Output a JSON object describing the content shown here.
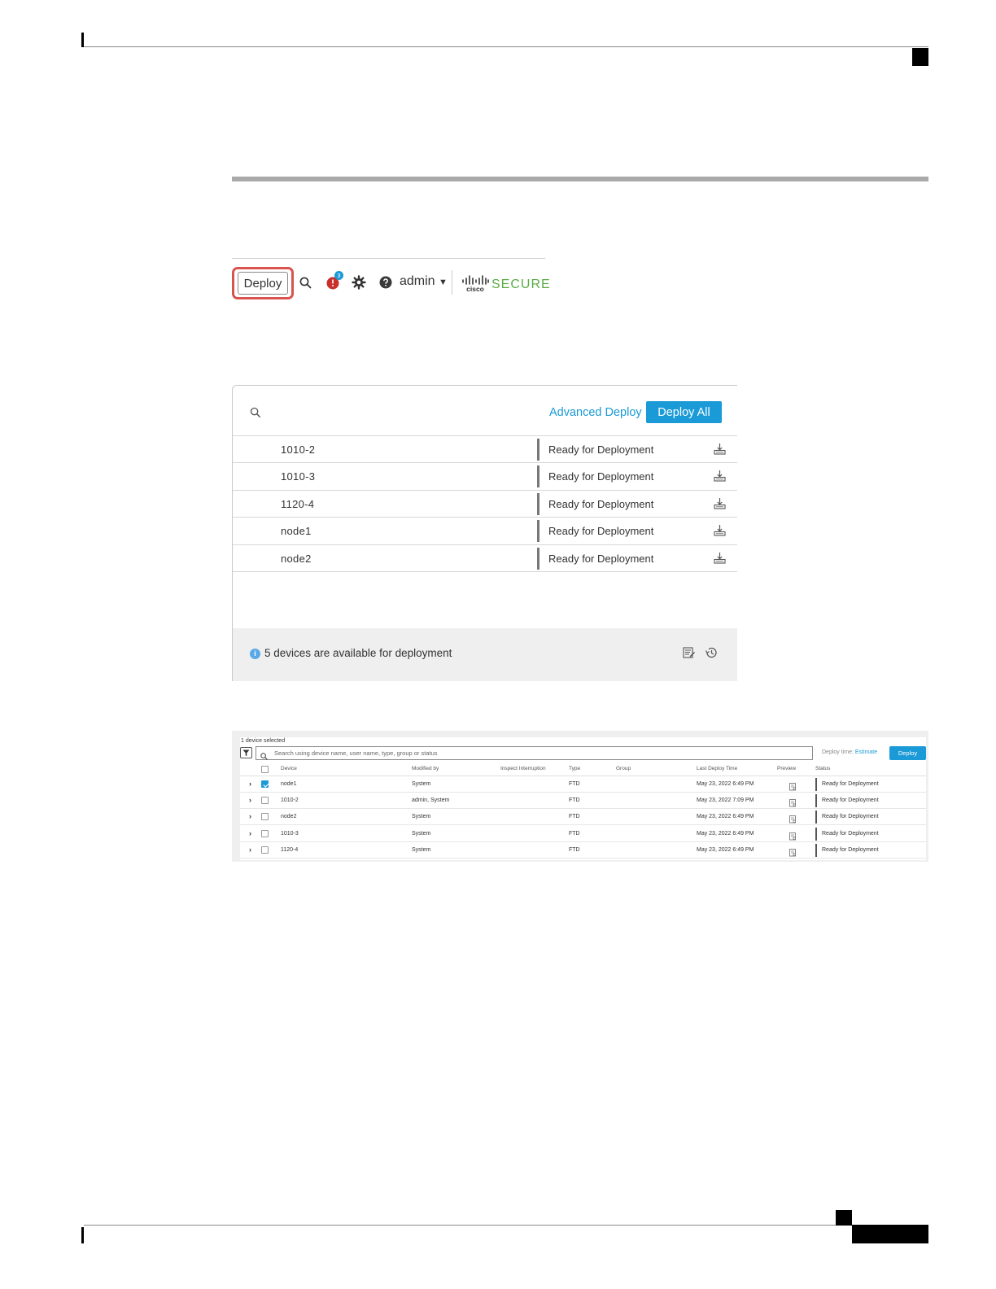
{
  "toolbar": {
    "deploy_label": "Deploy",
    "notification_count": "3",
    "user_label": "admin",
    "brand_label": "SECURE"
  },
  "popup": {
    "advanced_deploy_label": "Advanced Deploy",
    "deploy_all_label": "Deploy All",
    "devices": [
      {
        "name": "1010-2",
        "status": "Ready for Deployment"
      },
      {
        "name": "1010-3",
        "status": "Ready for Deployment"
      },
      {
        "name": "1120-4",
        "status": "Ready for Deployment"
      },
      {
        "name": "node1",
        "status": "Ready for Deployment"
      },
      {
        "name": "node2",
        "status": "Ready for Deployment"
      }
    ],
    "footer_message": "5 devices are available for deployment"
  },
  "advanced": {
    "selection_count": "1 device selected",
    "search_placeholder": "Search using device name, user name, type, group or status",
    "deploy_time_label": "Deploy time:",
    "estimate_link": "Estimate",
    "deploy_label": "Deploy",
    "columns": {
      "device": "Device",
      "modified_by": "Modified by",
      "inspect": "Inspect Interruption",
      "type": "Type",
      "group": "Group",
      "last_deploy": "Last Deploy Time",
      "preview": "Preview",
      "status": "Status"
    },
    "rows": [
      {
        "device": "node1",
        "modified_by": "System",
        "inspect": "",
        "type": "FTD",
        "group": "",
        "last_deploy": "May 23, 2022 6:49 PM",
        "status": "Ready for Deployment",
        "checked": true
      },
      {
        "device": "1010-2",
        "modified_by": "admin, System",
        "inspect": "",
        "type": "FTD",
        "group": "",
        "last_deploy": "May 23, 2022 7:09 PM",
        "status": "Ready for Deployment",
        "checked": false
      },
      {
        "device": "node2",
        "modified_by": "System",
        "inspect": "",
        "type": "FTD",
        "group": "",
        "last_deploy": "May 23, 2022 6:49 PM",
        "status": "Ready for Deployment",
        "checked": false
      },
      {
        "device": "1010-3",
        "modified_by": "System",
        "inspect": "",
        "type": "FTD",
        "group": "",
        "last_deploy": "May 23, 2022 6:49 PM",
        "status": "Ready for Deployment",
        "checked": false
      },
      {
        "device": "1120-4",
        "modified_by": "System",
        "inspect": "",
        "type": "FTD",
        "group": "",
        "last_deploy": "May 23, 2022 6:49 PM",
        "status": "Ready for Deployment",
        "checked": false
      }
    ]
  }
}
